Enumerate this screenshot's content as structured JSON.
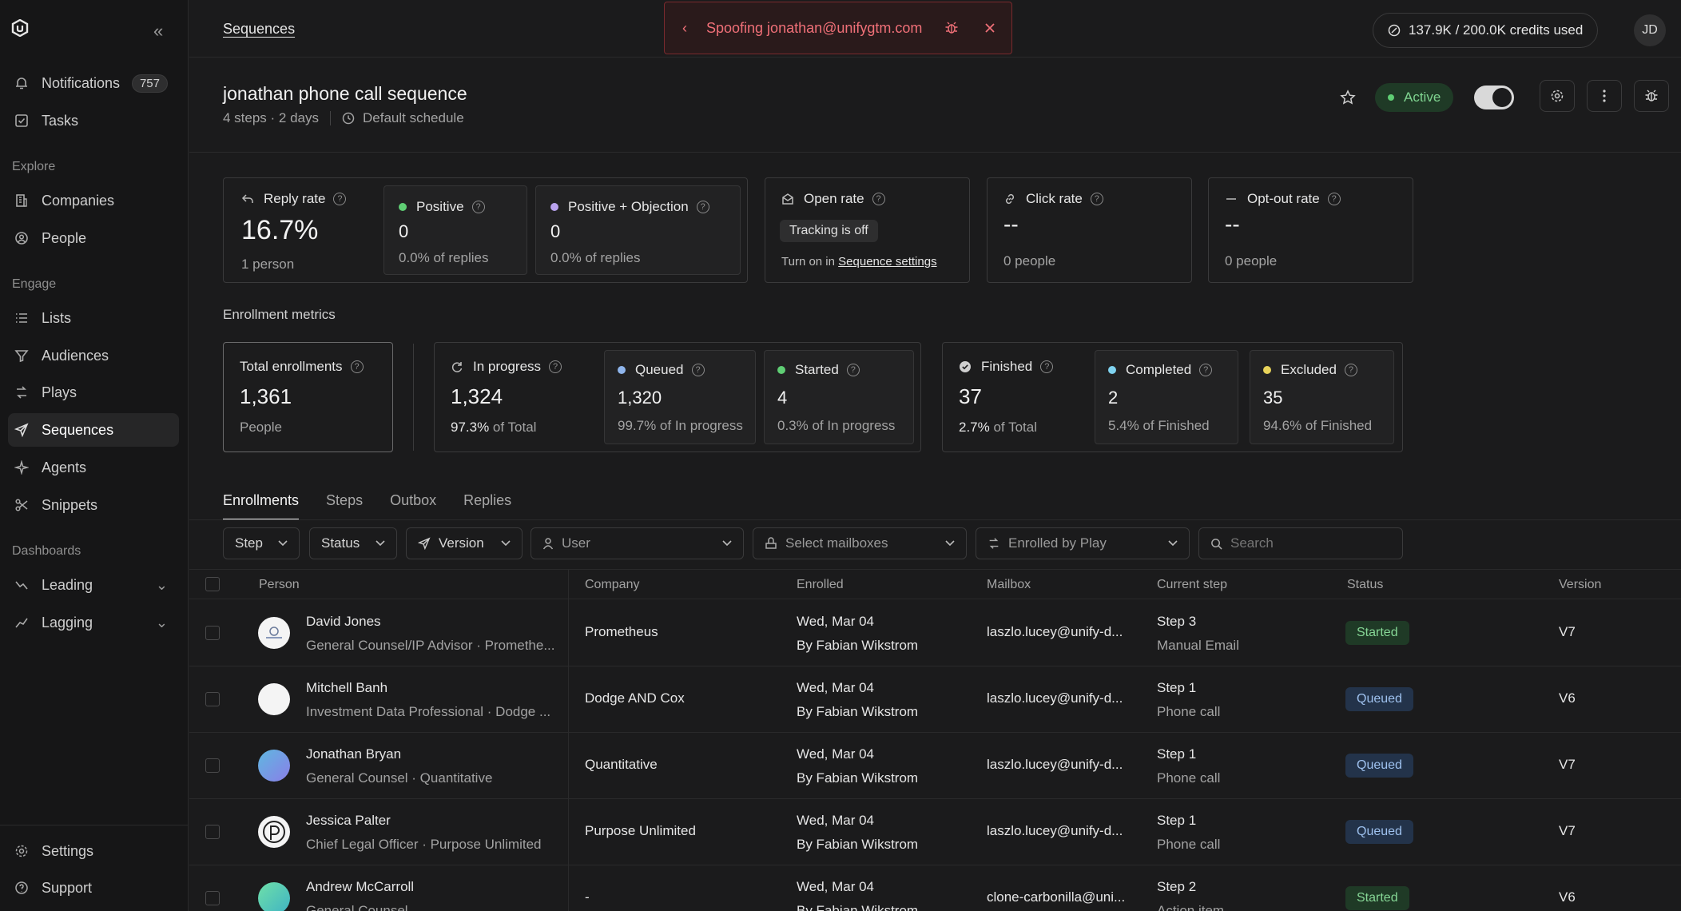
{
  "sidebar": {
    "top": [
      {
        "label": "Notifications",
        "icon": "bell-icon",
        "badge": "757"
      },
      {
        "label": "Tasks",
        "icon": "checkbox-icon"
      }
    ],
    "sections": [
      {
        "title": "Explore",
        "items": [
          {
            "label": "Companies",
            "icon": "building-icon"
          },
          {
            "label": "People",
            "icon": "user-circle-icon"
          }
        ]
      },
      {
        "title": "Engage",
        "items": [
          {
            "label": "Lists",
            "icon": "list-icon"
          },
          {
            "label": "Audiences",
            "icon": "funnel-icon"
          },
          {
            "label": "Plays",
            "icon": "plays-icon"
          },
          {
            "label": "Sequences",
            "icon": "send-icon"
          },
          {
            "label": "Agents",
            "icon": "sparkle-icon"
          },
          {
            "label": "Snippets",
            "icon": "scissors-icon"
          }
        ]
      },
      {
        "title": "Dashboards",
        "items": [
          {
            "label": "Leading",
            "icon": "trend-up-icon"
          },
          {
            "label": "Lagging",
            "icon": "trend-line-icon"
          }
        ]
      }
    ],
    "bottom": [
      {
        "label": "Settings",
        "icon": "gear-icon"
      },
      {
        "label": "Support",
        "icon": "help-circle-icon"
      }
    ]
  },
  "topbar": {
    "breadcrumb": "Sequences",
    "spoof_text": "Spoofing jonathan@unifygtm.com",
    "credits": "137.9K / 200.0K credits used",
    "avatar": "JD"
  },
  "header": {
    "title": "jonathan phone call sequence",
    "meta": "4 steps · 2 days",
    "schedule": "Default schedule",
    "status": "Active"
  },
  "metrics": {
    "reply": {
      "label": "Reply rate",
      "value": "16.7%",
      "sub": "1 person"
    },
    "positive": {
      "label": "Positive",
      "value": "0",
      "sub": "0.0% of replies"
    },
    "positive_objection": {
      "label": "Positive + Objection",
      "value": "0",
      "sub": "0.0% of replies"
    },
    "open": {
      "label": "Open rate",
      "pill": "Tracking is off",
      "sub_prefix": "Turn on in ",
      "sub_link": "Sequence settings"
    },
    "click": {
      "label": "Click rate",
      "value": "--",
      "sub": "0 people"
    },
    "optout": {
      "label": "Opt-out rate",
      "value": "--",
      "sub": "0 people"
    }
  },
  "enrollment": {
    "section_title": "Enrollment metrics",
    "total": {
      "label": "Total enrollments",
      "value": "1,361",
      "sub": "People"
    },
    "in_progress": {
      "label": "In progress",
      "value": "1,324",
      "pct": "97.3%",
      "sub": " of Total"
    },
    "queued": {
      "label": "Queued",
      "value": "1,320",
      "sub": "99.7% of In progress"
    },
    "started": {
      "label": "Started",
      "value": "4",
      "sub": "0.3% of In progress"
    },
    "finished": {
      "label": "Finished",
      "value": "37",
      "pct": "2.7%",
      "sub": " of Total"
    },
    "completed": {
      "label": "Completed",
      "value": "2",
      "sub": "5.4% of Finished"
    },
    "excluded": {
      "label": "Excluded",
      "value": "35",
      "sub": "94.6% of Finished"
    }
  },
  "tabs": [
    "Enrollments",
    "Steps",
    "Outbox",
    "Replies"
  ],
  "filters": {
    "step": "Step",
    "status": "Status",
    "version": "Version",
    "user": "User",
    "mailboxes": "Select mailboxes",
    "play": "Enrolled by Play",
    "search_placeholder": "Search"
  },
  "table": {
    "columns": [
      "Person",
      "Company",
      "Enrolled",
      "Mailbox",
      "Current step",
      "Status",
      "Version"
    ],
    "rows": [
      {
        "name": "David Jones",
        "title": "General Counsel/IP Advisor · Promethe...",
        "company": "Prometheus",
        "enrolled": "Wed, Mar 04",
        "by": "By Fabian Wikstrom",
        "mailbox": "laszlo.lucey@unify-d...",
        "step": "Step 3",
        "step_type": "Manual Email",
        "status": "Started",
        "version": "V7"
      },
      {
        "name": "Mitchell Banh",
        "title": "Investment Data Professional · Dodge ...",
        "company": "Dodge AND Cox",
        "enrolled": "Wed, Mar 04",
        "by": "By Fabian Wikstrom",
        "mailbox": "laszlo.lucey@unify-d...",
        "step": "Step 1",
        "step_type": "Phone call",
        "status": "Queued",
        "version": "V6"
      },
      {
        "name": "Jonathan Bryan",
        "title": "General Counsel · Quantitative",
        "company": "Quantitative",
        "enrolled": "Wed, Mar 04",
        "by": "By Fabian Wikstrom",
        "mailbox": "laszlo.lucey@unify-d...",
        "step": "Step 1",
        "step_type": "Phone call",
        "status": "Queued",
        "version": "V7"
      },
      {
        "name": "Jessica Palter",
        "title": "Chief Legal Officer · Purpose Unlimited",
        "company": "Purpose Unlimited",
        "enrolled": "Wed, Mar 04",
        "by": "By Fabian Wikstrom",
        "mailbox": "laszlo.lucey@unify-d...",
        "step": "Step 1",
        "step_type": "Phone call",
        "status": "Queued",
        "version": "V7"
      },
      {
        "name": "Andrew McCarroll",
        "title": "General Counsel",
        "company": "-",
        "enrolled": "Wed, Mar 04",
        "by": "By Fabian Wikstrom",
        "mailbox": "clone-carbonilla@uni...",
        "step": "Step 2",
        "step_type": "Action item",
        "status": "Started",
        "version": "V6"
      }
    ]
  }
}
